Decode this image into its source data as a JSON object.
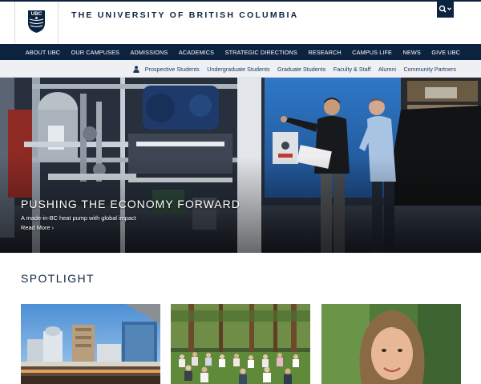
{
  "header": {
    "university_name": "THE UNIVERSITY OF BRITISH COLUMBIA",
    "logo_text": "UBC",
    "search_icon": "search-icon",
    "chevron_icon": "chevron-down-icon"
  },
  "main_nav": {
    "items": [
      {
        "label": "ABOUT UBC"
      },
      {
        "label": "OUR CAMPUSES"
      },
      {
        "label": "ADMISSIONS"
      },
      {
        "label": "ACADEMICS"
      },
      {
        "label": "STRATEGIC DIRECTIONS"
      },
      {
        "label": "RESEARCH"
      },
      {
        "label": "CAMPUS LIFE"
      },
      {
        "label": "NEWS"
      },
      {
        "label": "GIVE UBC"
      }
    ]
  },
  "audience_nav": {
    "icon": "person-icon",
    "items": [
      {
        "label": "Prospective Students"
      },
      {
        "label": "Undergraduate Students"
      },
      {
        "label": "Graduate Students"
      },
      {
        "label": "Faculty & Staff"
      },
      {
        "label": "Alumni"
      },
      {
        "label": "Community Partners"
      }
    ]
  },
  "hero": {
    "title": "PUSHING THE ECONOMY FORWARD",
    "subtitle": "A made-in-BC heat pump with global impact",
    "link_label": "Read More ›"
  },
  "spotlight": {
    "title": "SPOTLIGHT",
    "cards": [
      {
        "image": "campus-buildings-photo"
      },
      {
        "image": "outdoor-yoga-class-photo"
      },
      {
        "image": "woman-portrait-photo"
      }
    ]
  },
  "colors": {
    "brand_navy": "#0c2340",
    "audience_bar_bg": "#eef0f3",
    "audience_text": "#1c3a63"
  }
}
